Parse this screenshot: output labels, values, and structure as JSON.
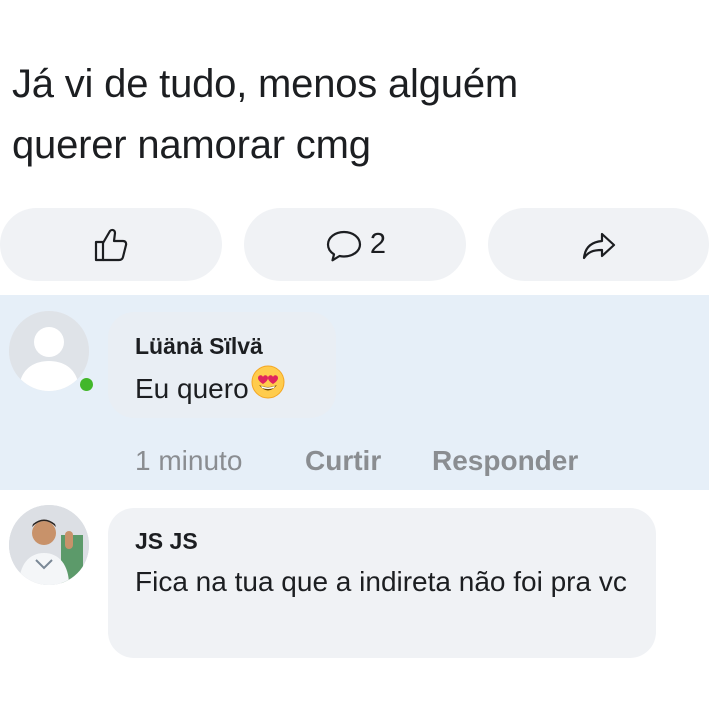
{
  "post": {
    "text_line1": "Já vi de tudo, menos alguém",
    "text_line2": "querer namorar cmg"
  },
  "actions": {
    "like_icon": "thumbs-up-icon",
    "comment_icon": "comment-bubble-icon",
    "comment_count": "2",
    "share_icon": "share-arrow-icon"
  },
  "comments": [
    {
      "author": "Lüänä Sïlvä",
      "text": "Eu quero",
      "emoji": "heart-eyes-emoji",
      "online": true,
      "time": "1 minuto",
      "like_label": "Curtir",
      "reply_label": "Responder"
    },
    {
      "author": "JS JS",
      "text": "Fica na tua que a indireta não foi pra vc"
    }
  ],
  "colors": {
    "highlight_bg": "#e6eff8",
    "bubble_bg": "#f0f2f5",
    "online_green": "#42b72a",
    "meta_gray": "#8a8d91"
  }
}
